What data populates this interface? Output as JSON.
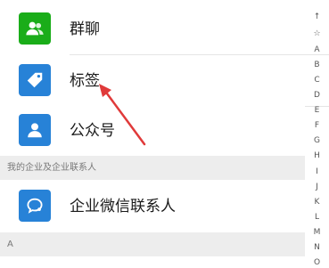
{
  "contacts": {
    "group_chat": {
      "label": "群聊",
      "icon": "group-chat-icon",
      "color": "#1aad19"
    },
    "tags": {
      "label": "标签",
      "icon": "tag-icon",
      "color": "#2782d7"
    },
    "official_accounts": {
      "label": "公众号",
      "icon": "official-account-icon",
      "color": "#2782d7"
    },
    "enterprise_section": "我的企业及企业联系人",
    "enterprise_contacts": {
      "label": "企业微信联系人",
      "icon": "wecom-icon",
      "color": "#2782d7"
    },
    "section_a": "A"
  },
  "index_bar": [
    "↑",
    "☆",
    "A",
    "B",
    "C",
    "D",
    "E",
    "F",
    "G",
    "H",
    "I",
    "J",
    "K",
    "L",
    "M",
    "N",
    "O"
  ],
  "annotation": {
    "color": "#e03a3a"
  }
}
